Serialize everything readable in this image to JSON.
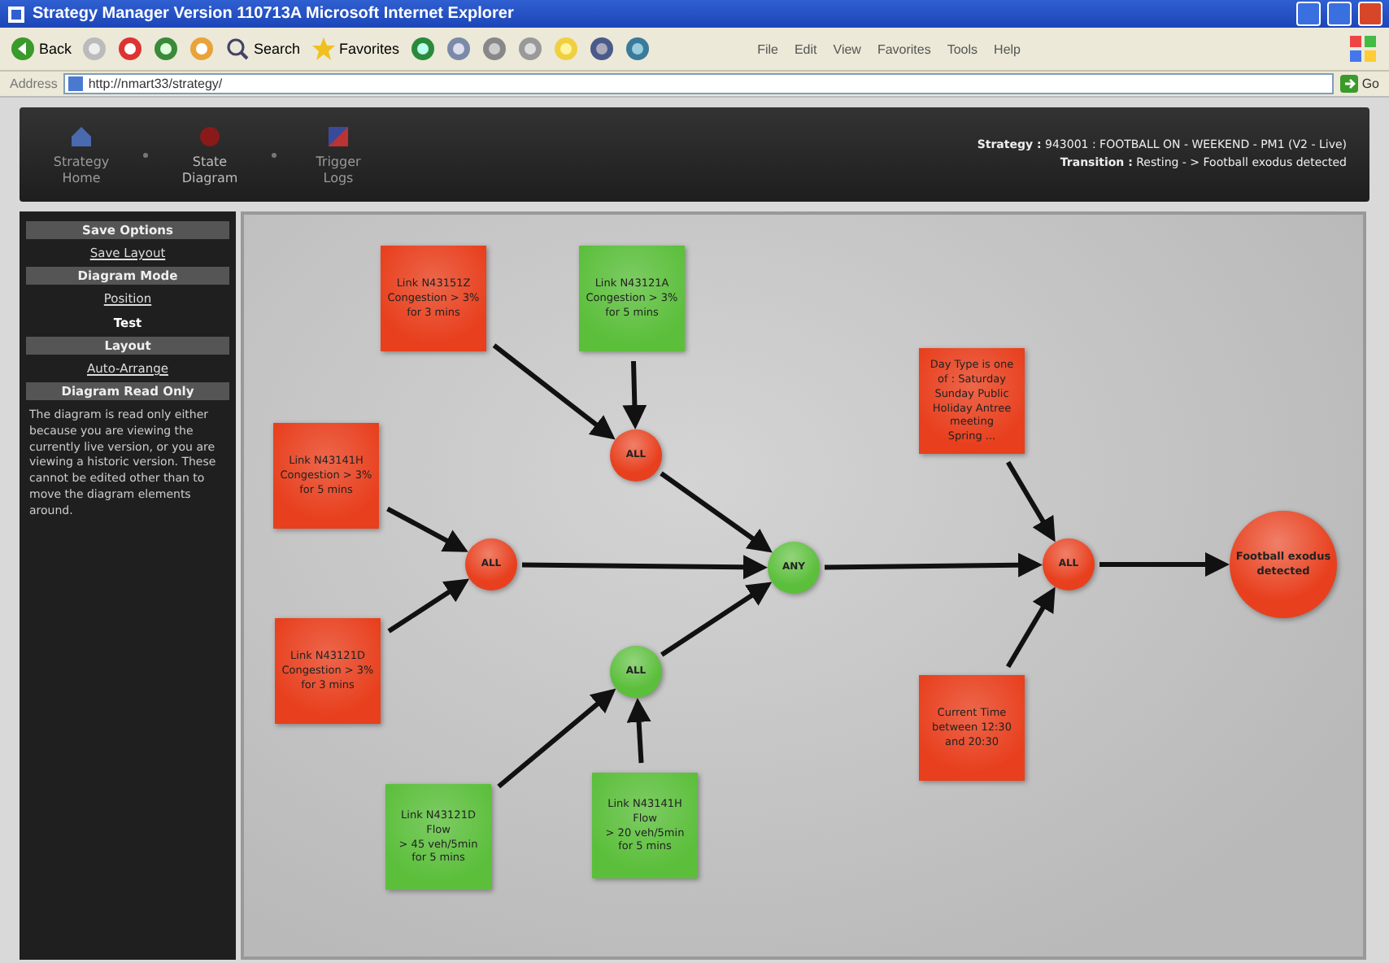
{
  "window": {
    "title": "Strategy Manager  Version 110713A  Microsoft Internet Explorer"
  },
  "toolbar": {
    "back": "Back",
    "search": "Search",
    "favorites": "Favorites"
  },
  "menu": [
    "File",
    "Edit",
    "View",
    "Favorites",
    "Tools",
    "Help"
  ],
  "address": {
    "label": "Address",
    "value": "http://nmart33/strategy/",
    "go": "Go"
  },
  "nav": [
    {
      "label": "Strategy Home",
      "selected": false
    },
    {
      "label": "State Diagram",
      "selected": true
    },
    {
      "label": "Trigger Logs",
      "selected": false
    }
  ],
  "info": [
    "**Strategy :** 943001 : FOOTBALL ON - WEEKEND - PM1 (V2 - Live)",
    "**Transition :** Resting - > Football exodus detected"
  ],
  "sidebar": {
    "items": [
      {
        "kind": "header",
        "label": "Save Options"
      },
      {
        "kind": "link",
        "label": "Save Layout"
      },
      {
        "kind": "header",
        "label": "Diagram Mode"
      },
      {
        "kind": "link",
        "label": "Position"
      },
      {
        "kind": "current",
        "label": "Test"
      },
      {
        "kind": "header",
        "label": "Layout"
      },
      {
        "kind": "link",
        "label": "Auto-Arrange"
      },
      {
        "kind": "header",
        "label": "Diagram Read Only"
      }
    ],
    "note": "The diagram is read only either because you are viewing the currently live version, or you are viewing a historic version. These cannot be edited other than to move the diagram elements around."
  },
  "diagram": {
    "nodes": [
      {
        "kind": "condition",
        "color": "#e8401e",
        "lines": [
          "Link N43151Z",
          "Congestion > 3%",
          "for 3 mins"
        ]
      },
      {
        "kind": "condition",
        "color": "#5cbf3c",
        "lines": [
          "Link N43121A",
          "Congestion > 3%",
          "for 5 mins"
        ]
      },
      {
        "kind": "condition",
        "color": "#e8401e",
        "lines": [
          "Link N43141H",
          "Congestion > 3%",
          "for 5 mins"
        ]
      },
      {
        "kind": "condition",
        "color": "#e8401e",
        "lines": [
          "Link N43121D",
          "Congestion > 3%",
          "for 3 mins"
        ]
      },
      {
        "kind": "condition",
        "color": "#5cbf3c",
        "lines": [
          "Link N43121D",
          "Flow",
          "> 45 veh/5min",
          "for 5 mins"
        ]
      },
      {
        "kind": "condition",
        "color": "#5cbf3c",
        "lines": [
          "Link N43141H",
          "Flow",
          "> 20 veh/5min",
          "for 5 mins"
        ]
      },
      {
        "kind": "condition",
        "color": "#e8401e",
        "lines": [
          "Day Type is one",
          "of : Saturday",
          "Sunday Public",
          "Holiday Antree",
          "meeting",
          "Spring ..."
        ]
      },
      {
        "kind": "condition",
        "color": "#e8401e",
        "lines": [
          "Current Time",
          "between 12:30",
          "and 20:30"
        ]
      },
      {
        "kind": "gate",
        "color": "#e8401e",
        "lines": [
          "ALL"
        ]
      },
      {
        "kind": "gate",
        "color": "#e8401e",
        "lines": [
          "ALL"
        ]
      },
      {
        "kind": "gate",
        "color": "#5cbf3c",
        "lines": [
          "ANY"
        ]
      },
      {
        "kind": "gate",
        "color": "#5cbf3c",
        "lines": [
          "ALL"
        ]
      },
      {
        "kind": "gate",
        "color": "#e8401e",
        "lines": [
          "ALL"
        ]
      },
      {
        "kind": "state",
        "color": "#e8401e",
        "lines": [
          "Football exodus",
          "detected"
        ]
      }
    ]
  }
}
